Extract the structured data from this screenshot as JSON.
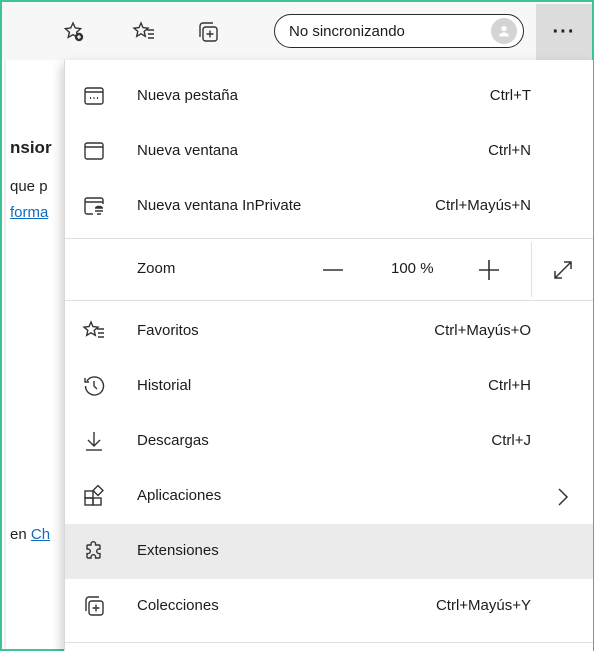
{
  "toolbar": {
    "sync_label": "No sincronizando",
    "more_label": "···"
  },
  "background_page": {
    "heading_fragment": "nsior",
    "line1_fragment": "que p",
    "link1_fragment": "forma",
    "line2_prefix": "en ",
    "link2_fragment": "Ch"
  },
  "menu": {
    "items": [
      {
        "label": "Nueva pestaña",
        "shortcut": "Ctrl+T",
        "icon": "new-tab-icon"
      },
      {
        "label": "Nueva ventana",
        "shortcut": "Ctrl+N",
        "icon": "new-window-icon"
      },
      {
        "label": "Nueva ventana InPrivate",
        "shortcut": "Ctrl+Mayús+N",
        "icon": "inprivate-icon"
      },
      {
        "label": "Favoritos",
        "shortcut": "Ctrl+Mayús+O",
        "icon": "favorites-icon"
      },
      {
        "label": "Historial",
        "shortcut": "Ctrl+H",
        "icon": "history-icon"
      },
      {
        "label": "Descargas",
        "shortcut": "Ctrl+J",
        "icon": "download-icon"
      },
      {
        "label": "Aplicaciones",
        "shortcut": "",
        "icon": "apps-icon"
      },
      {
        "label": "Extensiones",
        "shortcut": "",
        "icon": "extensions-icon",
        "highlighted": true
      },
      {
        "label": "Colecciones",
        "shortcut": "Ctrl+Mayús+Y",
        "icon": "collections-icon"
      }
    ],
    "zoom": {
      "label": "Zoom",
      "value": "100 %"
    }
  },
  "colors": {
    "frame_border": "#3cc39a",
    "highlight": "#ebebeb",
    "link": "#0f6cbd",
    "toolbar_bg": "#f7f7f7"
  }
}
